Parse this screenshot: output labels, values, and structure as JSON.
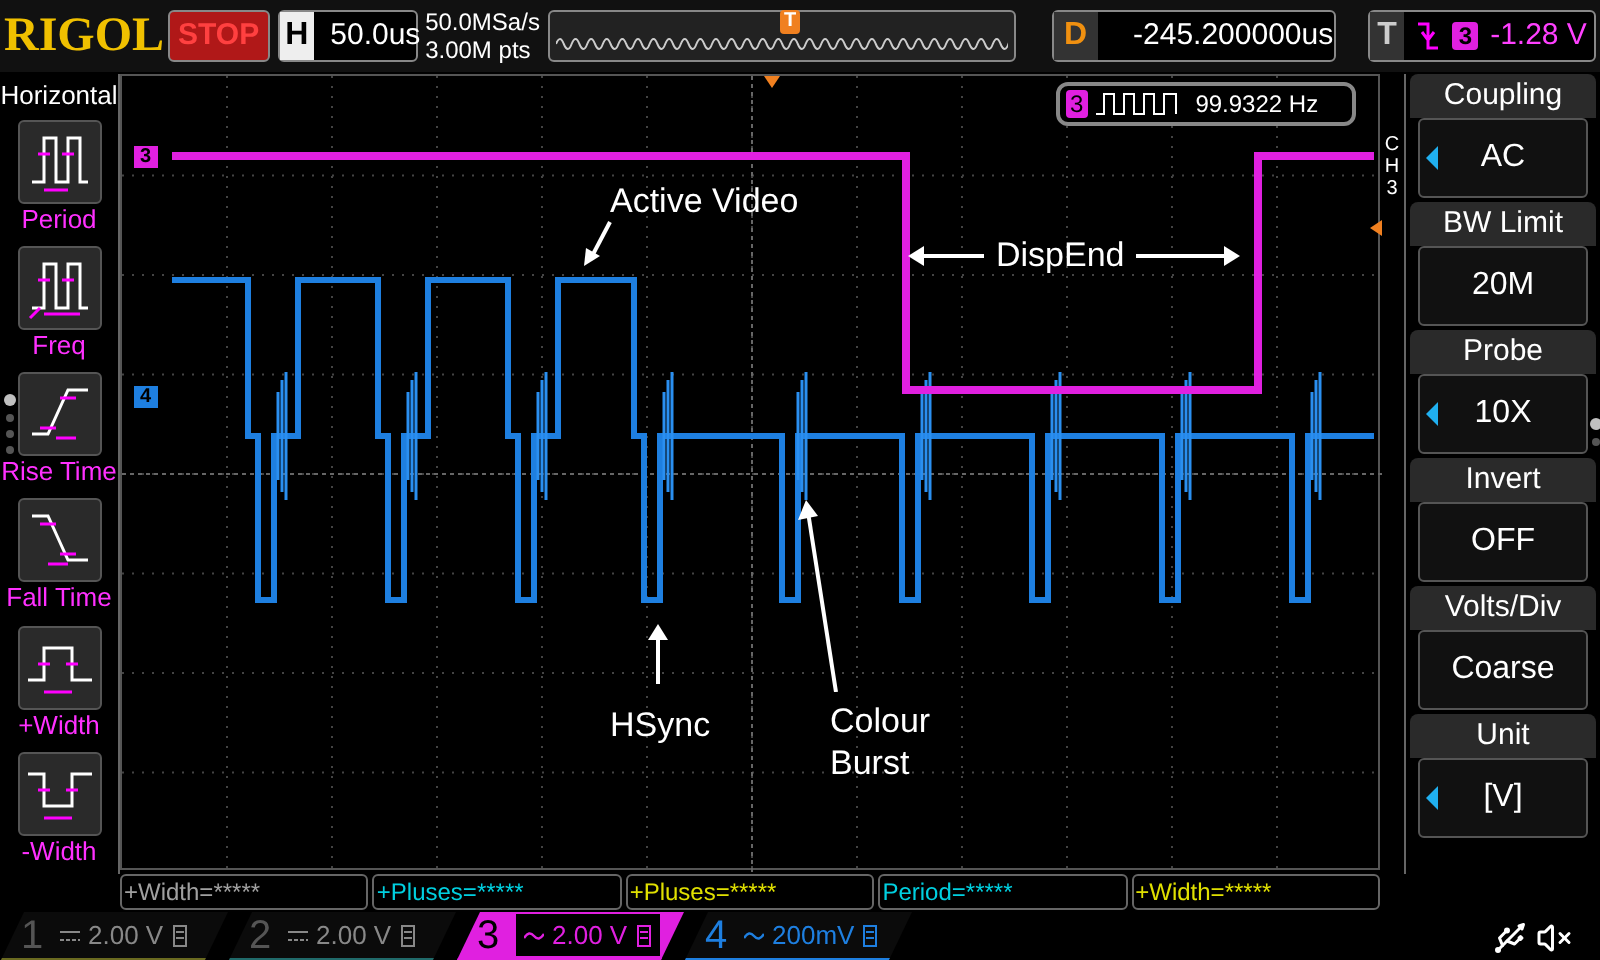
{
  "top_bar": {
    "logo": "RIGOL",
    "run_state": "STOP",
    "horizontal": {
      "label": "H",
      "value": "50.0us"
    },
    "sample_rate": "50.0MSa/s",
    "memory_depth": "3.00M pts",
    "trigger_marker": "T",
    "delay": {
      "label": "D",
      "value": "-245.200000us"
    },
    "trigger": {
      "label": "T",
      "source": "3",
      "level": "-1.28 V"
    }
  },
  "left_menu": {
    "title": "Horizontal",
    "items": [
      {
        "kind": "period",
        "label": "Period"
      },
      {
        "kind": "freq",
        "label": "Freq"
      },
      {
        "kind": "rise",
        "label": "Rise Time"
      },
      {
        "kind": "fall",
        "label": "Fall Time"
      },
      {
        "kind": "pwidth",
        "label": "+Width"
      },
      {
        "kind": "nwidth",
        "label": "-Width"
      }
    ],
    "pages": [
      {
        "selected": true
      },
      {
        "selected": false
      },
      {
        "selected": false
      },
      {
        "selected": false
      }
    ]
  },
  "plot": {
    "channel_markers": [
      {
        "label": "3",
        "color": "#e020e0"
      },
      {
        "label": "4",
        "color": "#1e7fe0"
      }
    ],
    "frequency_readout": {
      "channel": "3",
      "value": "99.9322 Hz"
    },
    "annotations": [
      {
        "kind": "active_video",
        "text": "Active Video"
      },
      {
        "kind": "dispend",
        "text": "DispEnd"
      },
      {
        "kind": "hsync",
        "text": "HSync"
      },
      {
        "kind": "burst",
        "text": "Colour Burst"
      }
    ]
  },
  "right_menu": {
    "title": "CH3",
    "items": [
      {
        "label": "Coupling",
        "value": "AC",
        "adjustable": true
      },
      {
        "label": "BW Limit",
        "value": "20M",
        "adjustable": false
      },
      {
        "label": "Probe",
        "value": "10X",
        "adjustable": true
      },
      {
        "label": "Invert",
        "value": "OFF",
        "adjustable": false
      },
      {
        "label": "Volts/Div",
        "value": "Coarse",
        "adjustable": false
      },
      {
        "label": "Unit",
        "value": "[V]",
        "adjustable": true
      }
    ],
    "pages": [
      {
        "selected": true
      },
      {
        "selected": false
      }
    ]
  },
  "measurements": [
    {
      "text": "+Width=*****",
      "color": "#a0a0a0"
    },
    {
      "text": "+Pluses=*****",
      "color": "#00d0e0"
    },
    {
      "text": "+Pluses=*****",
      "color": "#e0e000"
    },
    {
      "text": "Period=*****",
      "color": "#00d0e0"
    },
    {
      "text": "+Width=*****",
      "color": "#e0e000"
    }
  ],
  "channels": [
    {
      "number": "1",
      "kind": "dc",
      "scale": "2.00 V",
      "enabled": false,
      "selected": false,
      "color": "#6a6a20"
    },
    {
      "number": "2",
      "kind": "dc",
      "scale": "2.00 V",
      "enabled": false,
      "selected": false,
      "color": "#206a6a"
    },
    {
      "number": "3",
      "kind": "ac",
      "scale": "2.00 V",
      "enabled": true,
      "selected": true,
      "color": "#e020e0"
    },
    {
      "number": "4",
      "kind": "ac",
      "scale": "200mV",
      "enabled": true,
      "selected": false,
      "color": "#1e7fe0"
    }
  ]
}
